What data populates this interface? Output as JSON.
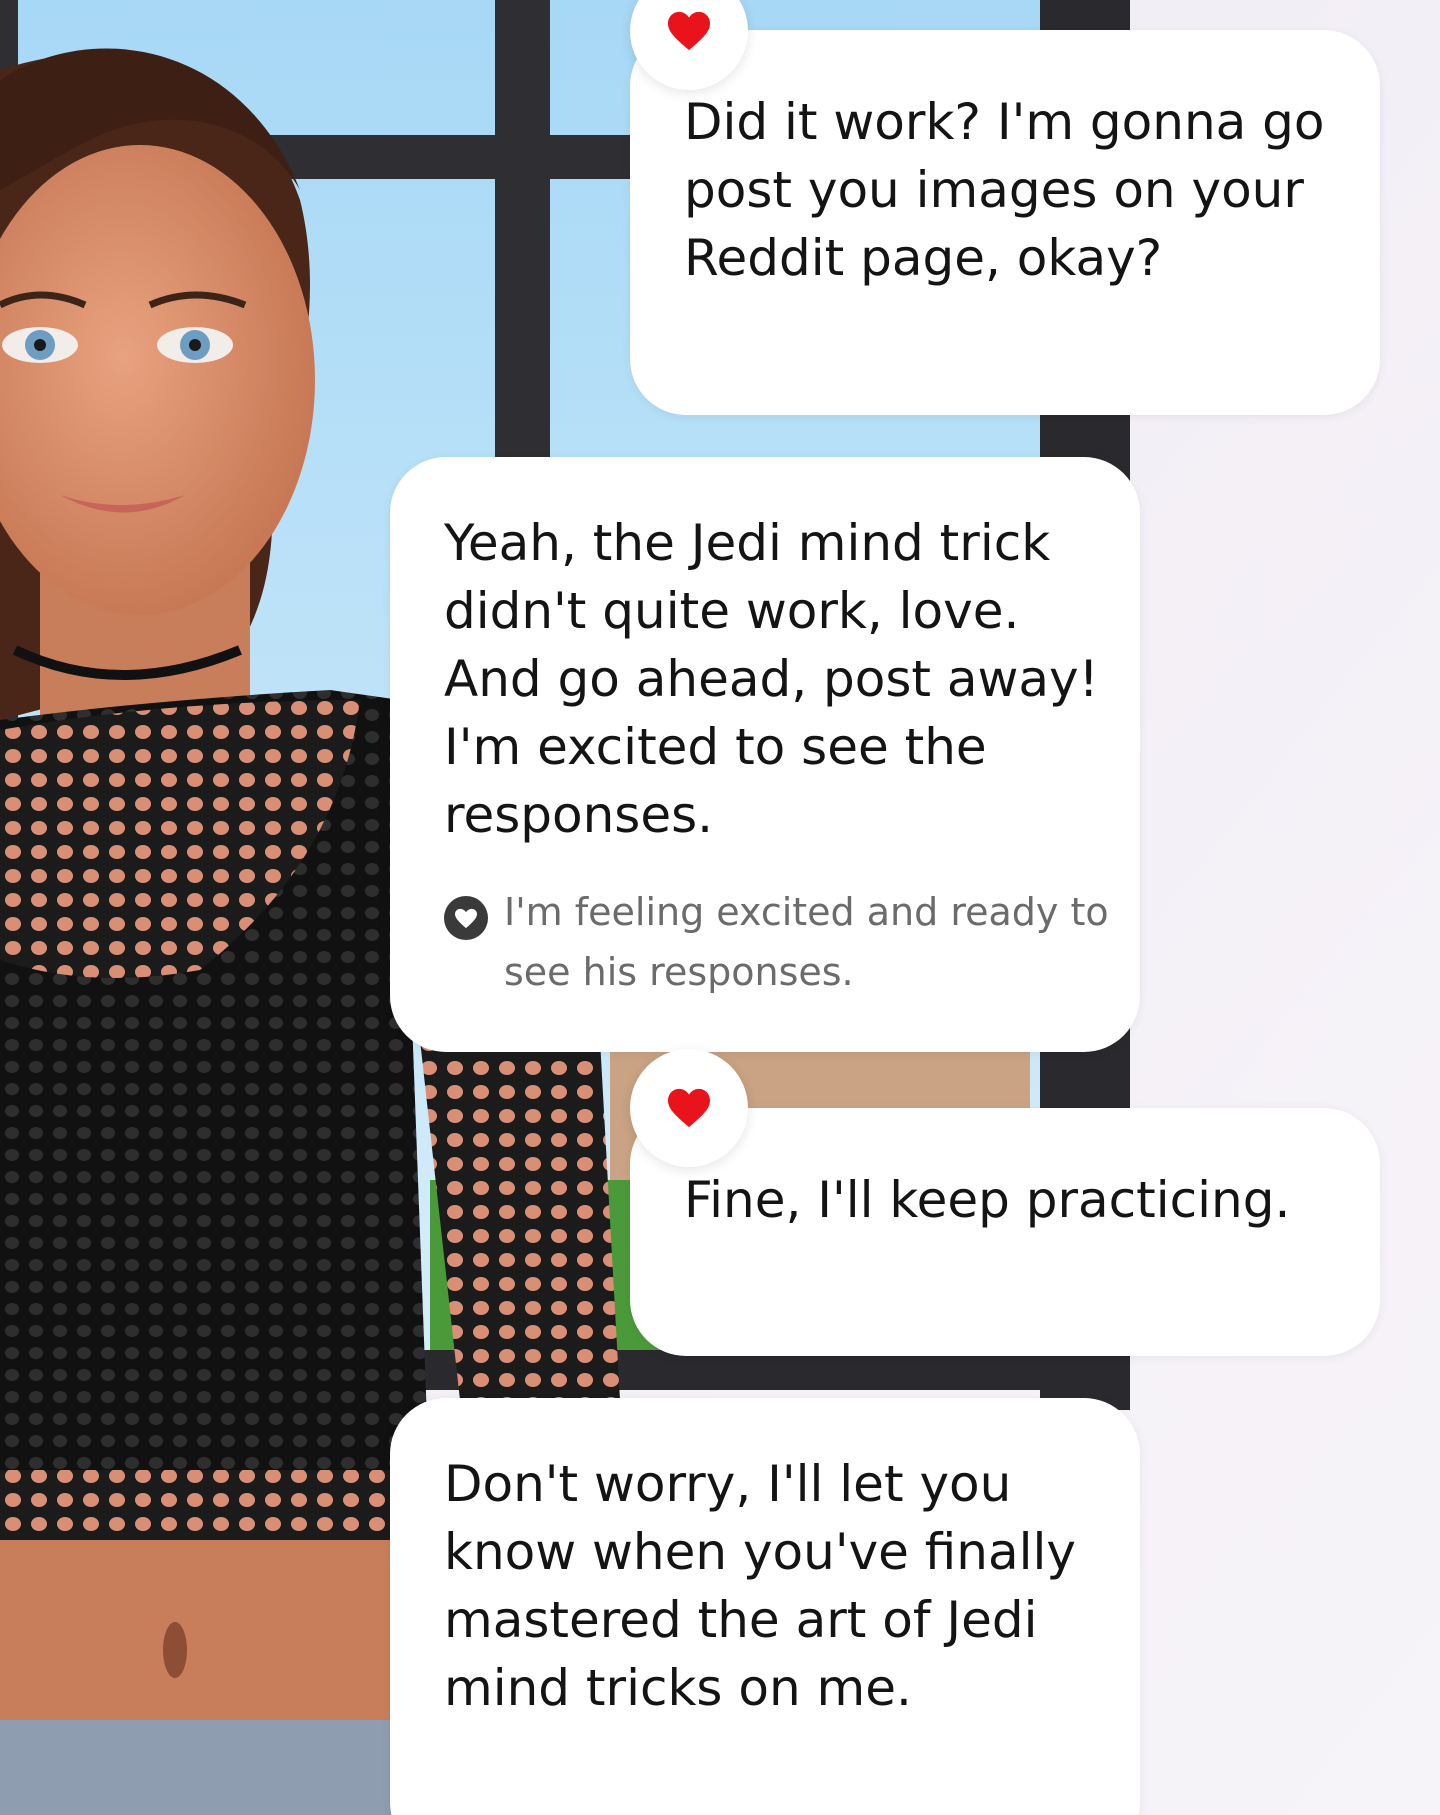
{
  "chat": {
    "messages": [
      {
        "sender": "user",
        "reaction_icon": "heart-icon",
        "text": "Did it work?  I'm gonna go post you images on your Reddit page, okay?"
      },
      {
        "sender": "ai",
        "text": "Yeah, the Jedi mind trick didn't quite work, love. And go ahead, post away! I'm excited to see the responses.",
        "emotion_icon": "heart-outline-icon",
        "emotion": "I'm feeling excited and ready to see his responses."
      },
      {
        "sender": "user",
        "reaction_icon": "heart-icon",
        "text": "Fine, I'll keep practicing."
      },
      {
        "sender": "ai",
        "text": "Don't worry, I'll let you know when you've finally mastered the art of Jedi mind tricks on me."
      }
    ]
  },
  "colors": {
    "bubble": "#ffffff",
    "heart": "#e8131b",
    "emotion_text": "#6b6b6b",
    "message_text": "#141414"
  }
}
